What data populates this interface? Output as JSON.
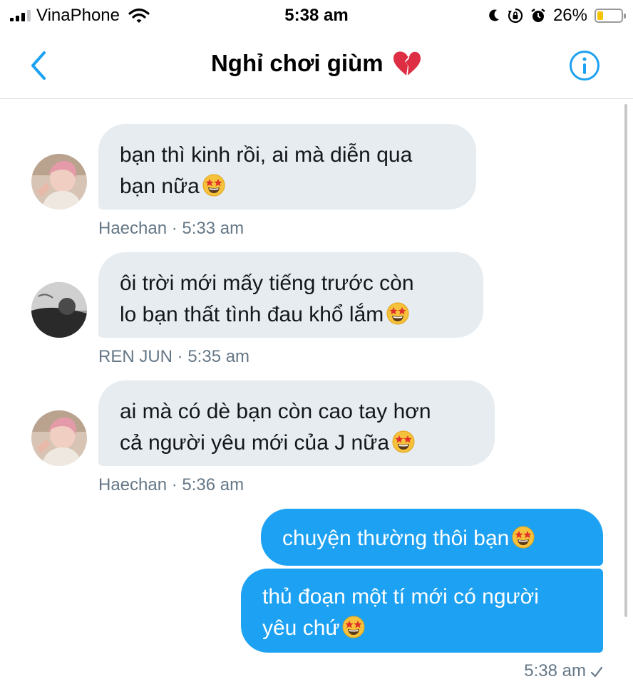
{
  "status_bar": {
    "carrier": "VinaPhone",
    "time": "5:38 am",
    "battery_percent": "26%",
    "battery_level": 0.26,
    "battery_color": "#f5c400",
    "icons": [
      "signal-icon",
      "wifi-icon",
      "moon-icon",
      "orientation-lock-icon",
      "alarm-icon",
      "battery-icon"
    ]
  },
  "header": {
    "title": "Nghỉ chơi giùm",
    "title_emoji": "broken-heart-icon",
    "back_icon": "chevron-left-icon",
    "info_icon": "info-icon",
    "accent_color": "#1da1f2"
  },
  "messages": [
    {
      "direction": "incoming",
      "lines": [
        "bạn thì kinh rồi, ai mà diễn qua",
        "bạn nữa"
      ],
      "emoji": "star-struck-icon",
      "meta": "Haechan · 5:33 am"
    },
    {
      "direction": "incoming",
      "lines": [
        "ôi trời mới mấy tiếng trước còn",
        "lo bạn thất tình đau khổ lắm"
      ],
      "emoji": "star-struck-icon",
      "meta": "REN JUN · 5:35 am"
    },
    {
      "direction": "incoming",
      "lines": [
        "ai mà có dè bạn còn cao tay hơn",
        "cả người yêu mới của J nữa"
      ],
      "emoji": "star-struck-icon",
      "meta": "Haechan · 5:36 am"
    },
    {
      "direction": "outgoing",
      "lines": [
        "chuyện thường thôi bạn"
      ],
      "emoji": "star-struck-icon"
    },
    {
      "direction": "outgoing",
      "lines": [
        "thủ đoạn một tí mới có người",
        "yêu chứ"
      ],
      "emoji": "star-struck-icon",
      "meta": "5:38 am",
      "status_icon": "checkmark-icon"
    }
  ],
  "colors": {
    "incoming_bubble": "#e6ecf0",
    "outgoing_bubble": "#1da1f2",
    "meta_text": "#657786"
  }
}
